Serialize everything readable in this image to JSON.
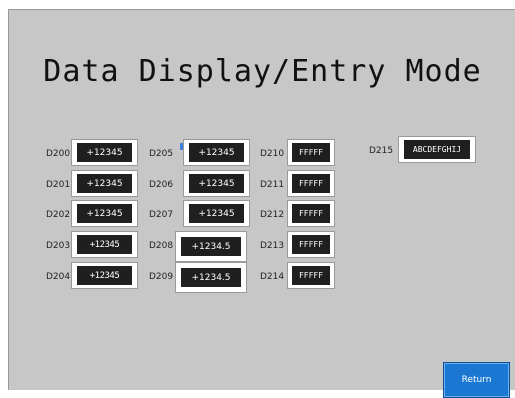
{
  "screen": {
    "title": "Data Display/Entry Mode"
  },
  "registers": [
    {
      "label": "D200",
      "value": "+12345"
    },
    {
      "label": "D201",
      "value": "+12345"
    },
    {
      "label": "D202",
      "value": "+12345"
    },
    {
      "label": "D203",
      "value": "+12345"
    },
    {
      "label": "D204",
      "value": "+12345"
    },
    {
      "label": "D205",
      "value": "+12345"
    },
    {
      "label": "D206",
      "value": "+12345"
    },
    {
      "label": "D207",
      "value": "+12345"
    },
    {
      "label": "D208",
      "value": "+1234.5"
    },
    {
      "label": "D209",
      "value": "+1234.5"
    },
    {
      "label": "D210",
      "value": "FFFFF"
    },
    {
      "label": "D211",
      "value": "FFFFF"
    },
    {
      "label": "D212",
      "value": "FFFFF"
    },
    {
      "label": "D213",
      "value": "FFFFF"
    },
    {
      "label": "D214",
      "value": "FFFFF"
    },
    {
      "label": "D215",
      "value": "ABCDEFGHIJ"
    }
  ],
  "return_button": {
    "label": "Return"
  },
  "colors": {
    "background": "#c7c7c7",
    "display": "#1f1f1f",
    "return_button": "#1a78d3"
  }
}
